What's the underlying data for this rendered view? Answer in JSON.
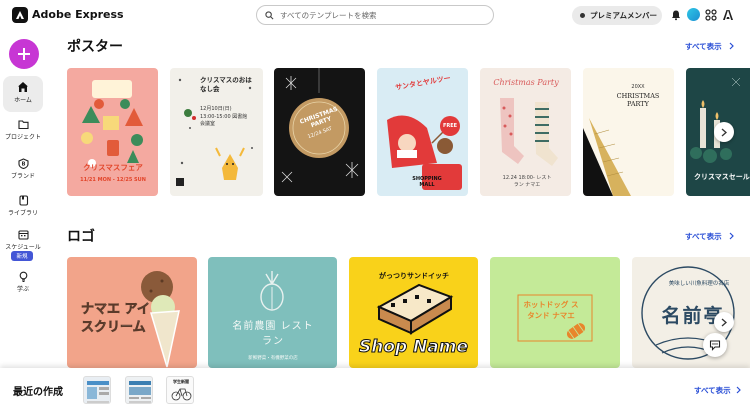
{
  "app": {
    "name": "Adobe Express"
  },
  "search": {
    "placeholder": "すべてのテンプレートを検索",
    "icon": "search-icon"
  },
  "header": {
    "premium_label": "プレミアムメンバー"
  },
  "sidebar": {
    "items": [
      {
        "label": "ホーム",
        "icon": "home-icon"
      },
      {
        "label": "プロジェクト",
        "icon": "folder-icon"
      },
      {
        "label": "ブランド",
        "icon": "brand-icon"
      },
      {
        "label": "ライブラリ",
        "icon": "library-icon"
      },
      {
        "label": "スケジュール",
        "icon": "calendar-icon"
      },
      {
        "label": "学ぶ",
        "icon": "lightbulb-icon"
      }
    ],
    "new_badge": "新規"
  },
  "sections": [
    {
      "title": "ポスター",
      "see_all": "すべて表示",
      "cards": [
        {
          "text": "クリスマスフェア",
          "sub": "11/21 MON - 12/25 SUN"
        },
        {
          "text": "クリスマスのおはなし会",
          "sub": "12月10日(日) 13:00-15:00 図書館会議室"
        },
        {
          "text": "CHRISTMAS PARTY",
          "sub": "12/24 SAT"
        },
        {
          "text": "サンタとヤルツー",
          "sub": "SHOPPING MALL",
          "badge": "FREE"
        },
        {
          "text": "Christmas Party",
          "sub": "12.24 18:00- レストラン ナマエ"
        },
        {
          "text": "CHRISTMAS PARTY",
          "sub": "20XX"
        },
        {
          "text": "クリスマスセール"
        }
      ]
    },
    {
      "title": "ロゴ",
      "see_all": "すべて表示",
      "cards": [
        {
          "text": "ナマエ アイスクリーム"
        },
        {
          "text": "名前農園 レストラン",
          "sub": "新鮮野菜・有機野菜の店"
        },
        {
          "text": "Shop Name",
          "sub": "がっつりサンドイッチ"
        },
        {
          "text": "ホットドッグ スタンド ナマエ"
        },
        {
          "text": "名前亭",
          "sub": "美味しい川魚料理の名店"
        }
      ]
    }
  ],
  "recent": {
    "title": "最近の作成",
    "see_all": "すべて表示",
    "thumb_text": "学生新聞"
  }
}
